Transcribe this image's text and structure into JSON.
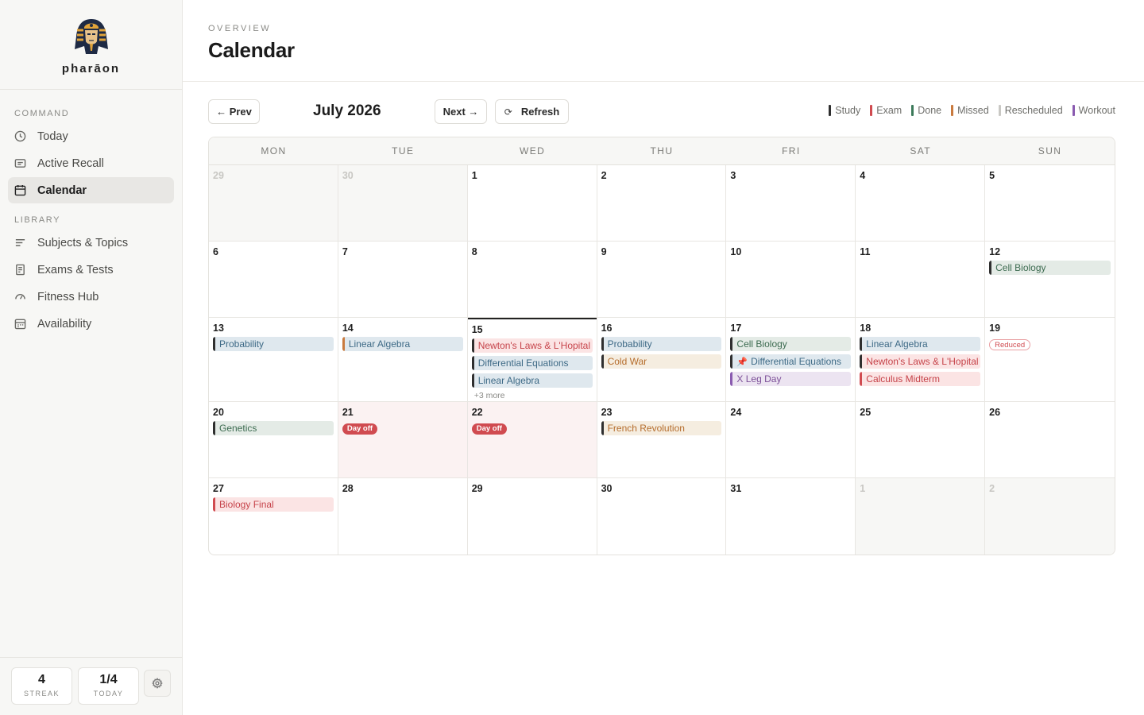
{
  "brand": {
    "name": "pharāon"
  },
  "sidebar": {
    "sections": [
      {
        "heading": "COMMAND",
        "items": [
          {
            "label": "Today",
            "icon": "clock-icon",
            "active": false
          },
          {
            "label": "Active Recall",
            "icon": "card-icon",
            "active": false
          },
          {
            "label": "Calendar",
            "icon": "calendar-icon",
            "active": true
          }
        ]
      },
      {
        "heading": "LIBRARY",
        "items": [
          {
            "label": "Subjects & Topics",
            "icon": "list-icon",
            "active": false
          },
          {
            "label": "Exams & Tests",
            "icon": "document-icon",
            "active": false
          },
          {
            "label": "Fitness Hub",
            "icon": "gauge-icon",
            "active": false
          },
          {
            "label": "Availability",
            "icon": "schedule-icon",
            "active": false
          }
        ]
      }
    ],
    "stats": {
      "streak_value": "4",
      "streak_label": "STREAK",
      "today_value": "1/4",
      "today_label": "TODAY"
    }
  },
  "header": {
    "eyebrow": "OVERVIEW",
    "title": "Calendar"
  },
  "toolbar": {
    "prev": "← Prev",
    "month": "July 2026",
    "next": "Next →",
    "refresh": "Refresh"
  },
  "legend": [
    {
      "label": "Study",
      "color": "#2f2f2f"
    },
    {
      "label": "Exam",
      "color": "#d04b50"
    },
    {
      "label": "Done",
      "color": "#3c7a5a"
    },
    {
      "label": "Missed",
      "color": "#c97a3e"
    },
    {
      "label": "Rescheduled",
      "color": "#c9c8c4"
    },
    {
      "label": "Workout",
      "color": "#8a5bb0"
    }
  ],
  "calendar": {
    "weekdays": [
      "MON",
      "TUE",
      "WED",
      "THU",
      "FRI",
      "SAT",
      "SUN"
    ],
    "weeks": [
      [
        {
          "day": "29",
          "outside": true,
          "events": []
        },
        {
          "day": "30",
          "outside": true,
          "events": []
        },
        {
          "day": "1",
          "events": []
        },
        {
          "day": "2",
          "events": []
        },
        {
          "day": "3",
          "events": []
        },
        {
          "day": "4",
          "events": []
        },
        {
          "day": "5",
          "events": []
        }
      ],
      [
        {
          "day": "6",
          "events": []
        },
        {
          "day": "7",
          "events": []
        },
        {
          "day": "8",
          "events": []
        },
        {
          "day": "9",
          "events": []
        },
        {
          "day": "10",
          "events": []
        },
        {
          "day": "11",
          "events": []
        },
        {
          "day": "12",
          "events": [
            {
              "title": "Cell Biology",
              "style": "green"
            }
          ]
        }
      ],
      [
        {
          "day": "13",
          "events": [
            {
              "title": "Probability",
              "style": "blue"
            }
          ]
        },
        {
          "day": "14",
          "events": [
            {
              "title": "Linear Algebra",
              "style": "blue-orangebar"
            }
          ]
        },
        {
          "day": "15",
          "today": true,
          "events": [
            {
              "title": "Newton's Laws & L'Hopital",
              "style": "red-blackbar"
            },
            {
              "title": "Differential Equations",
              "style": "blue",
              "gap": true
            },
            {
              "title": "Linear Algebra",
              "style": "blue",
              "gap": true
            }
          ],
          "more": "+3 more"
        },
        {
          "day": "16",
          "events": [
            {
              "title": "Probability",
              "style": "blue"
            },
            {
              "title": "Cold War",
              "style": "orange",
              "gap": true
            }
          ]
        },
        {
          "day": "17",
          "events": [
            {
              "title": "Cell Biology",
              "style": "green"
            },
            {
              "title": "Differential Equations",
              "style": "blue",
              "gap": true,
              "pinned": true
            },
            {
              "title": "X Leg Day",
              "style": "purple",
              "gap": true
            }
          ]
        },
        {
          "day": "18",
          "events": [
            {
              "title": "Linear Algebra",
              "style": "blue"
            },
            {
              "title": "Newton's Laws & L'Hopital",
              "style": "red-blackbar",
              "gap": true
            },
            {
              "title": "Calculus Midterm",
              "style": "red",
              "gap": true
            }
          ]
        },
        {
          "day": "19",
          "badge": "Reduced",
          "badge_style": "reduced",
          "events": []
        }
      ],
      [
        {
          "day": "20",
          "events": [
            {
              "title": "Genetics",
              "style": "green"
            }
          ]
        },
        {
          "day": "21",
          "dayoff": true,
          "badge": "Day off",
          "badge_style": "dayoff",
          "events": []
        },
        {
          "day": "22",
          "dayoff": true,
          "badge": "Day off",
          "badge_style": "dayoff",
          "events": []
        },
        {
          "day": "23",
          "events": [
            {
              "title": "French Revolution",
              "style": "orange"
            }
          ]
        },
        {
          "day": "24",
          "events": []
        },
        {
          "day": "25",
          "events": []
        },
        {
          "day": "26",
          "events": []
        }
      ],
      [
        {
          "day": "27",
          "events": [
            {
              "title": "Biology Final",
              "style": "red"
            }
          ]
        },
        {
          "day": "28",
          "events": []
        },
        {
          "day": "29",
          "events": []
        },
        {
          "day": "30",
          "events": []
        },
        {
          "day": "31",
          "events": []
        },
        {
          "day": "1",
          "outside": true,
          "events": []
        },
        {
          "day": "2",
          "outside": true,
          "events": []
        }
      ]
    ]
  }
}
